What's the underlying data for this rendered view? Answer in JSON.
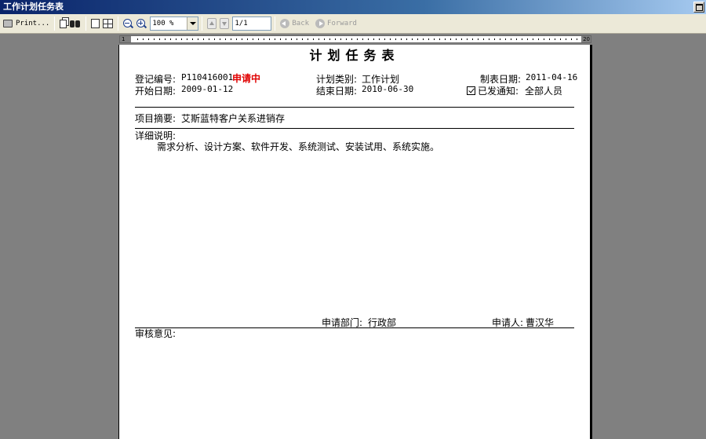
{
  "window": {
    "title": "工作计划任务表"
  },
  "toolbar": {
    "print_label": "Print...",
    "zoom_value": "100 %",
    "page_value": "1/1",
    "back_label": "Back",
    "forward_label": "Forward"
  },
  "ruler": {
    "start": "1",
    "end": "20"
  },
  "sheet": {
    "title": "计划任务表",
    "reg_no_label": "登记编号:",
    "reg_no_value": "P110416001",
    "status": "申请中",
    "status_color": "#e00000",
    "plan_type_label": "计划类别:",
    "plan_type_value": "工作计划",
    "created_label": "制表日期:",
    "created_value": "2011-04-16",
    "start_label": "开始日期:",
    "start_value": "2009-01-12",
    "end_label": "结束日期:",
    "end_value": "2010-06-30",
    "notified_label": "已发通知:",
    "notified_value": "全部人员",
    "notified_checked": true,
    "summary_label": "项目摘要:",
    "summary_value": "艾斯蓝特客户关系进销存",
    "detail_label": "详细说明:",
    "detail_value": "需求分析、设计方案、软件开发、系统测试、安装试用、系统实施。",
    "dept_label": "申请部门:",
    "dept_value": "行政部",
    "applicant_label": "申请人:",
    "applicant_value": "曹汉华",
    "review_label": "审核意见:"
  }
}
